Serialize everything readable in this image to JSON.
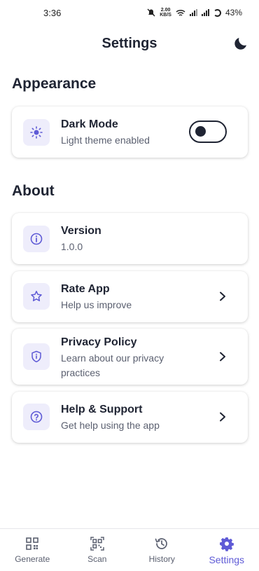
{
  "status_bar": {
    "time": "3:36",
    "net_speed_top": "2.00",
    "net_speed_bottom": "KB/S",
    "battery": "43%"
  },
  "header": {
    "title": "Settings",
    "theme_icon": "moon-icon"
  },
  "appearance": {
    "section_title": "Appearance",
    "dark_mode": {
      "title": "Dark Mode",
      "subtitle": "Light theme enabled",
      "icon": "sun-icon",
      "enabled": false
    }
  },
  "about": {
    "section_title": "About",
    "items": [
      {
        "title": "Version",
        "subtitle": "1.0.0",
        "icon": "info-icon"
      },
      {
        "title": "Rate App",
        "subtitle": "Help us improve",
        "icon": "star-icon"
      },
      {
        "title": "Privacy Policy",
        "subtitle": "Learn about our privacy practices",
        "icon": "shield-icon"
      },
      {
        "title": "Help & Support",
        "subtitle": "Get help using the app",
        "icon": "help-icon"
      }
    ]
  },
  "bottom_nav": {
    "items": [
      {
        "label": "Generate",
        "icon": "qr-generate-icon"
      },
      {
        "label": "Scan",
        "icon": "qr-scan-icon"
      },
      {
        "label": "History",
        "icon": "history-icon"
      },
      {
        "label": "Settings",
        "icon": "gear-icon",
        "active": true
      }
    ]
  },
  "colors": {
    "accent": "#5f5bd6",
    "icon_bg": "#eeedfb",
    "text": "#1f2433",
    "subtext": "#5b6070"
  }
}
